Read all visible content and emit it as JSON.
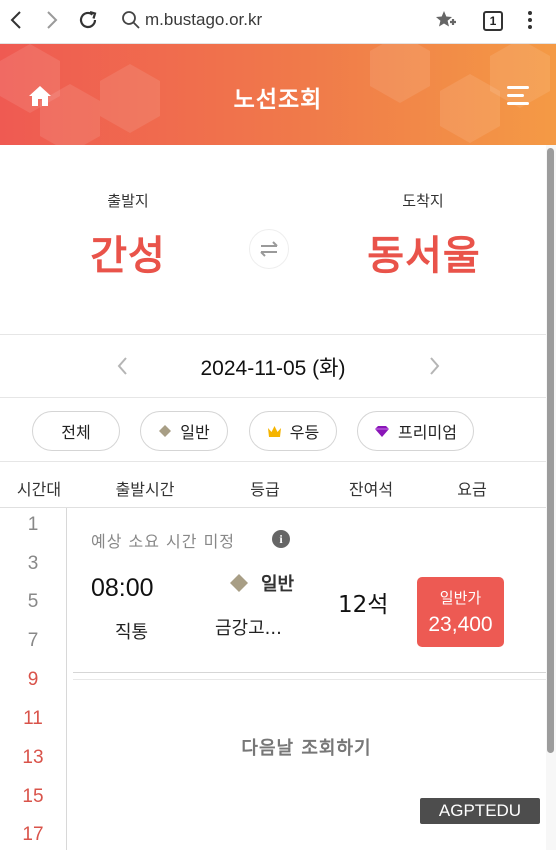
{
  "browser": {
    "url": "m.bustago.or.kr",
    "tab_count": "1"
  },
  "header": {
    "title": "노선조회"
  },
  "route": {
    "origin_label": "출발지",
    "origin": "간성",
    "destination_label": "도착지",
    "destination": "동서울"
  },
  "date": {
    "value": "2024-11-05 (화)"
  },
  "filters": [
    {
      "label": "전체"
    },
    {
      "label": "일반"
    },
    {
      "label": "우등"
    },
    {
      "label": "프리미엄"
    }
  ],
  "columns": [
    "시간대",
    "출발시간",
    "등급",
    "잔여석",
    "요금"
  ],
  "time_slots": [
    "1",
    "3",
    "5",
    "7",
    "9",
    "11",
    "13",
    "15",
    "17"
  ],
  "colors": {
    "brand": "#ef5a52",
    "past_slot": "#888888",
    "active_slot": "#d9534a"
  },
  "result": {
    "notice": "예상 소요 시간 미정",
    "info_icon": "i",
    "departure_time": "08:00",
    "route_type": "직통",
    "grade": "일반",
    "company": "금강고...",
    "seats": "12석",
    "price_label": "일반가",
    "price": "23,400"
  },
  "next_day": "다음날 조회하기",
  "watermark": "AGPTEDU"
}
